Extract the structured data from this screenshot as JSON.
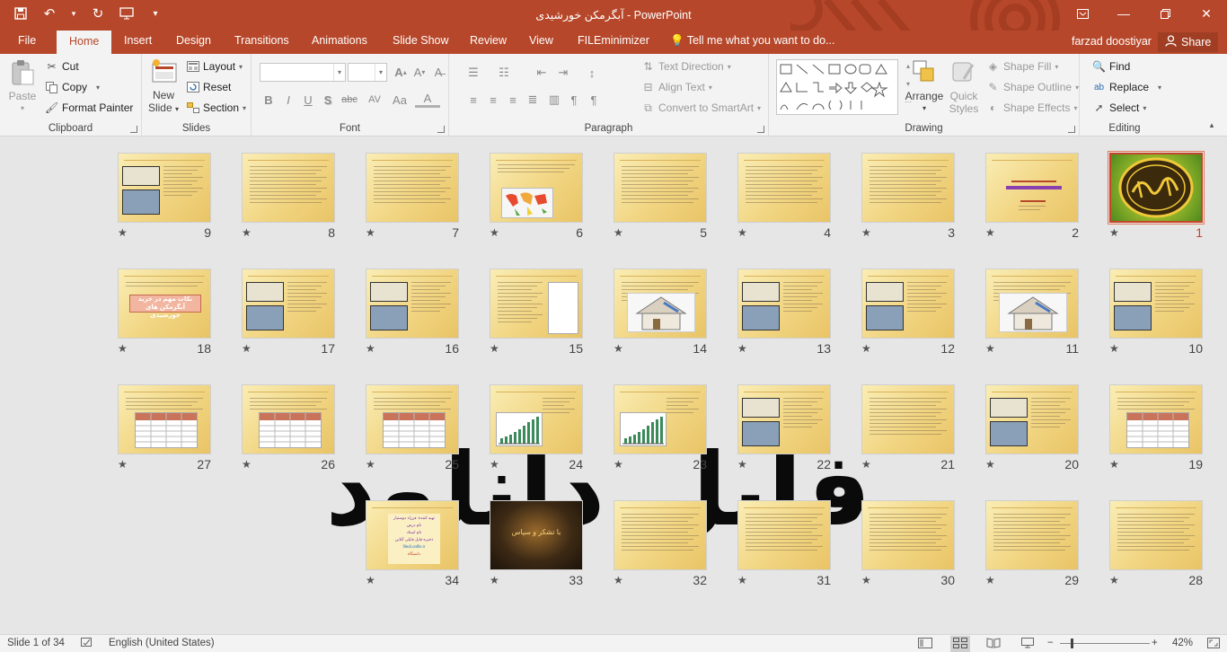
{
  "window": {
    "title": "آبگرمکن خورشیدی - PowerPoint",
    "user": "farzad doostiyar",
    "share_label": "Share"
  },
  "tabs": [
    "File",
    "Home",
    "Insert",
    "Design",
    "Transitions",
    "Animations",
    "Slide Show",
    "Review",
    "View",
    "FILEminimizer"
  ],
  "tell_me": "Tell me what you want to do...",
  "ribbon": {
    "clipboard": {
      "label": "Clipboard",
      "paste": "Paste",
      "cut": "Cut",
      "copy": "Copy",
      "format_painter": "Format Painter"
    },
    "slides": {
      "label": "Slides",
      "new_slide": "New",
      "new_slide2": "Slide",
      "layout": "Layout",
      "reset": "Reset",
      "section": "Section"
    },
    "font": {
      "label": "Font",
      "bold": "B",
      "italic": "I",
      "underline": "U",
      "shadow": "S",
      "strike": "abc",
      "spacing": "AV",
      "case": "Aa"
    },
    "paragraph": {
      "label": "Paragraph",
      "text_direction": "Text Direction",
      "align_text": "Align Text",
      "smartart": "Convert to SmartArt"
    },
    "drawing": {
      "label": "Drawing",
      "arrange": "Arrange",
      "quick_styles": "Quick",
      "quick_styles2": "Styles",
      "shape_fill": "Shape Fill",
      "shape_outline": "Shape Outline",
      "shape_effects": "Shape Effects"
    },
    "editing": {
      "label": "Editing",
      "find": "Find",
      "replace": "Replace",
      "select": "Select"
    }
  },
  "slides": [
    {
      "n": "1",
      "sel": true,
      "kind": "calligraphy"
    },
    {
      "n": "2",
      "kind": "title"
    },
    {
      "n": "3",
      "kind": "text"
    },
    {
      "n": "4",
      "kind": "text"
    },
    {
      "n": "5",
      "kind": "text"
    },
    {
      "n": "6",
      "kind": "map"
    },
    {
      "n": "7",
      "kind": "text"
    },
    {
      "n": "8",
      "kind": "text"
    },
    {
      "n": "9",
      "kind": "pics"
    },
    {
      "n": "10",
      "kind": "pics"
    },
    {
      "n": "11",
      "kind": "house"
    },
    {
      "n": "12",
      "kind": "pics"
    },
    {
      "n": "13",
      "kind": "pics"
    },
    {
      "n": "14",
      "kind": "house"
    },
    {
      "n": "15",
      "kind": "diagram"
    },
    {
      "n": "16",
      "kind": "pics"
    },
    {
      "n": "17",
      "kind": "pics"
    },
    {
      "n": "18",
      "kind": "label"
    },
    {
      "n": "19",
      "kind": "table"
    },
    {
      "n": "20",
      "kind": "pics"
    },
    {
      "n": "21",
      "kind": "text"
    },
    {
      "n": "22",
      "kind": "pics"
    },
    {
      "n": "23",
      "kind": "chart"
    },
    {
      "n": "24",
      "kind": "chart"
    },
    {
      "n": "25",
      "kind": "table"
    },
    {
      "n": "26",
      "kind": "table"
    },
    {
      "n": "27",
      "kind": "table"
    },
    {
      "n": "28",
      "kind": "text"
    },
    {
      "n": "29",
      "kind": "text"
    },
    {
      "n": "30",
      "kind": "text"
    },
    {
      "n": "31",
      "kind": "text"
    },
    {
      "n": "32",
      "kind": "text"
    },
    {
      "n": "33",
      "kind": "dark"
    },
    {
      "n": "34",
      "kind": "contact"
    }
  ],
  "slide_texts": {
    "s18_label": "نکات مهم در خرید آبگرمکن های خورشیدی",
    "s33_text": "با تشکر و سپاس",
    "s34_lines": [
      "تهیه کننده: فرزاد دوستیار",
      "نام درس",
      "نام استاد",
      "ذخیره فایل فایلی آنلاین",
      "filedi.onfile.ir",
      "دانشگاه"
    ]
  },
  "watermark": "فایل دانلود",
  "status": {
    "slide": "Slide 1 of 34",
    "lang": "English (United States)",
    "zoom": "42%"
  },
  "colors": {
    "accent": "#b7472a",
    "ribbon_bg": "#f3f3f3",
    "sorter_bg": "#e6e6e6"
  }
}
